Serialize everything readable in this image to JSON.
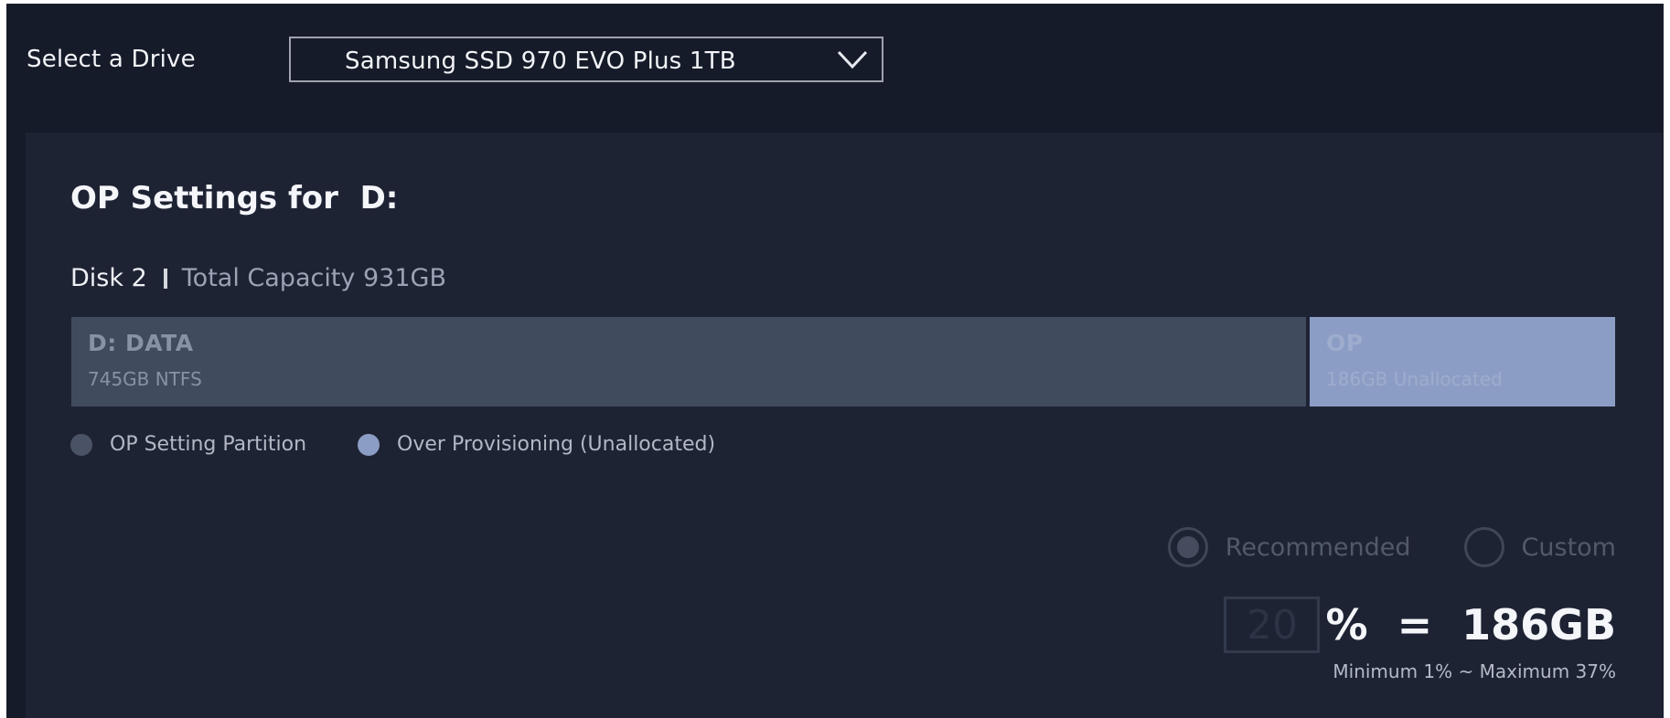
{
  "header": {
    "select_label": "Select a Drive",
    "selected_drive": "Samsung SSD 970 EVO Plus 1TB"
  },
  "op_settings": {
    "title": "OP Settings for  D:",
    "disk_name": "Disk 2",
    "total_capacity": "Total Capacity 931GB",
    "capacity_bar": {
      "data_fraction": 0.8,
      "segments": [
        {
          "name": "D: DATA",
          "detail": "745GB NTFS",
          "color": "#414b5e"
        },
        {
          "name": "OP",
          "detail": "186GB Unallocated",
          "color": "#8c9dc5"
        }
      ]
    },
    "legend": [
      {
        "label": "OP Setting Partition",
        "color": "#4a5366"
      },
      {
        "label": "Over Provisioning (Unallocated)",
        "color": "#8c9dc5"
      }
    ],
    "mode_options": [
      {
        "label": "Recommended",
        "selected": true
      },
      {
        "label": "Custom",
        "selected": false
      }
    ],
    "percent_value": "20",
    "result_text": "%  =  186GB",
    "range_note": "Minimum 1% ~ Maximum 37%"
  }
}
